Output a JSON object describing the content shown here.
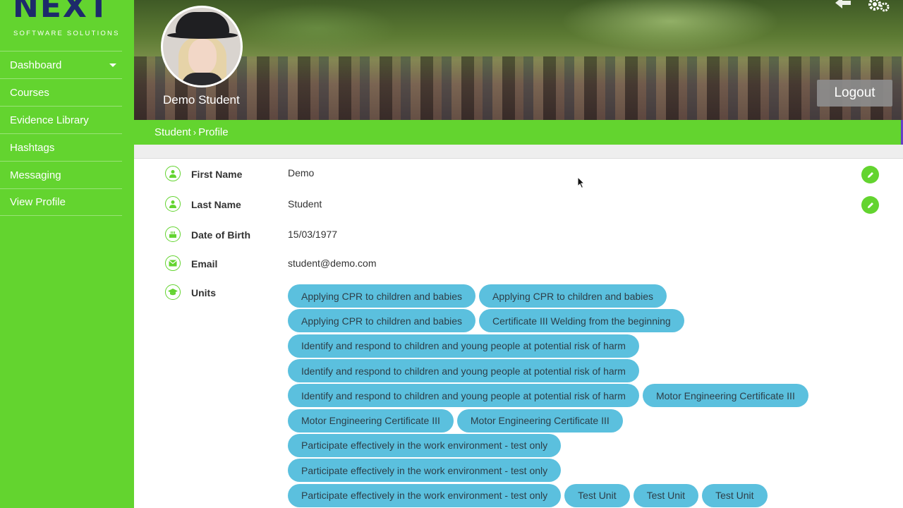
{
  "logo": {
    "name": "NEXT",
    "tagline": "SOFTWARE SOLUTIONS"
  },
  "sidebar": {
    "items": [
      {
        "label": "Dashboard",
        "has_dropdown": true
      },
      {
        "label": "Courses"
      },
      {
        "label": "Evidence Library"
      },
      {
        "label": "Hashtags"
      },
      {
        "label": "Messaging"
      },
      {
        "label": "View Profile"
      }
    ]
  },
  "header": {
    "user_name": "Demo Student",
    "logout_label": "Logout",
    "icons": [
      "back-arrow-icon",
      "gears-icon"
    ]
  },
  "breadcrumb": {
    "parent": "Student",
    "separator": "›",
    "current": "Profile"
  },
  "profile": {
    "first_name": {
      "label": "First Name",
      "value": "Demo",
      "icon": "user-icon"
    },
    "last_name": {
      "label": "Last Name",
      "value": "Student",
      "icon": "user-icon"
    },
    "dob": {
      "label": "Date of Birth",
      "value": "15/03/1977",
      "icon": "birthday-cake-icon"
    },
    "email": {
      "label": "Email",
      "value": "student@demo.com",
      "icon": "envelope-icon"
    },
    "units_label": "Units",
    "units_icon": "graduation-cap-icon"
  },
  "units": {
    "rows": [
      [
        "Applying CPR to children and babies",
        "Applying CPR to children and babies"
      ],
      [
        "Applying CPR to children and babies",
        "Certificate III Welding from the beginning"
      ],
      [
        "Identify and respond to children and young people at potential risk of harm"
      ],
      [
        "Identify and respond to children and young people at potential risk of harm"
      ],
      [
        "Identify and respond to children and young people at potential risk of harm",
        "Motor Engineering Certificate III"
      ],
      [
        "Motor Engineering Certificate III",
        "Motor Engineering Certificate III"
      ],
      [
        "Participate effectively in the work environment - test only"
      ],
      [
        "Participate effectively in the work environment - test only"
      ],
      [
        "Participate effectively in the work environment - test only",
        "Test Unit",
        "Test Unit",
        "Test Unit"
      ]
    ]
  },
  "colors": {
    "brand_green": "#63d42f",
    "chip_blue": "#5bc0de",
    "logo_navy": "#1d2a6b",
    "logout_gray": "#8c8c8c"
  }
}
